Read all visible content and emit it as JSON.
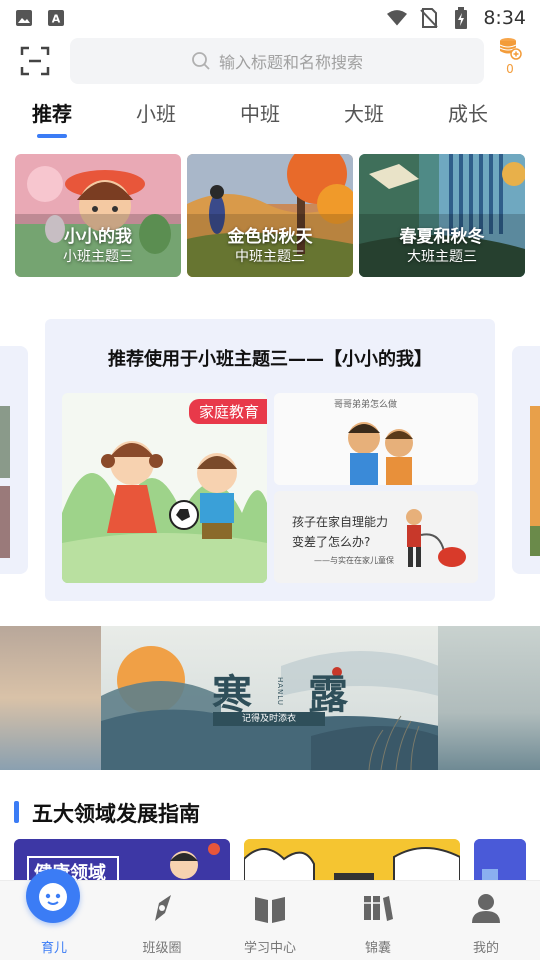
{
  "status_bar": {
    "time": "8:34",
    "icons": [
      "image-icon",
      "font-icon",
      "wifi-icon",
      "no-sim-icon",
      "battery-icon"
    ]
  },
  "header": {
    "search_placeholder": "输入标题和名称搜索",
    "coin_count": "0"
  },
  "tabs": [
    {
      "label": "推荐",
      "active": true
    },
    {
      "label": "小班"
    },
    {
      "label": "中班"
    },
    {
      "label": "大班"
    },
    {
      "label": "成长"
    }
  ],
  "themes": [
    {
      "title": "小小的我",
      "subtitle": "小班主题三"
    },
    {
      "title": "金色的秋天",
      "subtitle": "中班主题三"
    },
    {
      "title": "春夏和秋冬",
      "subtitle": "大班主题三"
    }
  ],
  "recommend": {
    "title": "推荐使用于小班主题三——【小小的我】",
    "tag": "家庭教育",
    "caption_top": "哥哥弟弟怎么做",
    "caption_bottom_line1": "孩子在家自理能力",
    "caption_bottom_line2": "变差了怎么办?",
    "caption_bottom_line3": "——与实在在家儿童保"
  },
  "banner": {
    "title_char1": "寒",
    "title_char2": "露",
    "pinyin": "HANLU",
    "subtitle": "记得及时添衣"
  },
  "section": {
    "title": "五大领域发展指南",
    "card_label": "健康领域"
  },
  "bottom_nav": [
    {
      "label": "育儿",
      "active": true
    },
    {
      "label": "班级圈"
    },
    {
      "label": "学习中心"
    },
    {
      "label": "锦囊"
    },
    {
      "label": "我的"
    }
  ],
  "colors": {
    "accent": "#3b7cf5",
    "tag_red": "#e8394a",
    "coin_orange": "#f39c3a"
  }
}
